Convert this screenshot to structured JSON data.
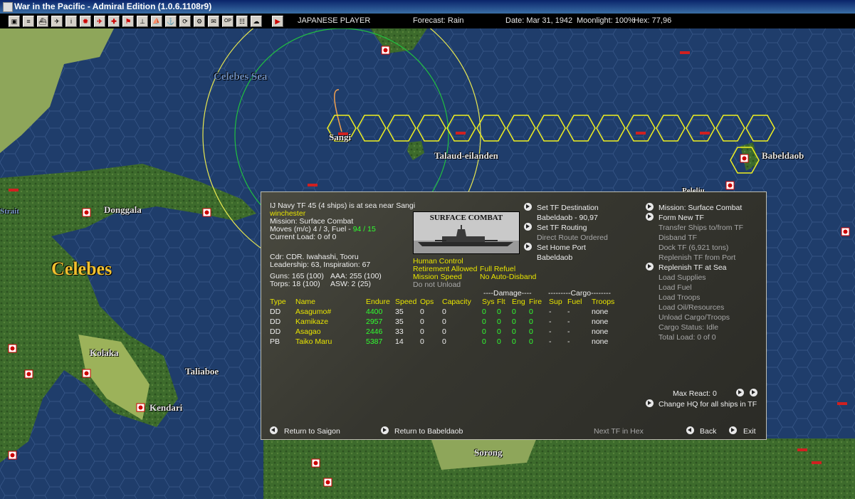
{
  "window": {
    "title": "War in the Pacific - Admiral Edition (1.0.6.1108r9)"
  },
  "toolbar": {
    "player": "JAPANESE PLAYER",
    "forecast": "Forecast: Rain",
    "date": "Date: Mar 31, 1942",
    "moonlight": "Moonlight: 100%",
    "hex": "Hex: 77,96",
    "button_icons": [
      "map-icon",
      "list-icon",
      "ships-icon",
      "air-icon",
      "info-icon",
      "flag-icon",
      "fighter-icon",
      "base-flag-icon",
      "carrier-icon",
      "landing-icon",
      "fleet-icon",
      "recycle-icon",
      "cycle-icon",
      "options-icon",
      "commands-icon",
      "report-icon",
      "end-turn-icon"
    ]
  },
  "map": {
    "labels": {
      "celebes_sea": "Celebes Sea",
      "sangi": "Sangi",
      "talaud": "Talaud-eilanden",
      "babeldaob": "Babeldaob",
      "donggala": "Donggala",
      "celebes": "Celebes",
      "kolaka": "Kolaka",
      "taliaboe": "Taliaboe",
      "kendari": "Kendari",
      "sorong": "Sorong",
      "peleliu": "Peleliu",
      "strait": "Strait"
    },
    "colors": {
      "sea": "#1f3d6b",
      "land": "#3a6b2a",
      "hex_path": "#f0f020",
      "range_inner": "#20c040"
    }
  },
  "tf": {
    "header": "IJ Navy TF 45 (4 ships) is at sea near Sangi",
    "flagship": "winchester",
    "mission": "Mission: Surface Combat",
    "moves_label": "Moves (m/c)  4 / 3, Fuel - ",
    "fuel": "94 / 15",
    "current_load": "Current Load:  0 of 0",
    "commander": "Cdr: CDR. Iwahashi, Tooru",
    "leadership": "Leadership: 63, Inspiration: 67",
    "guns": "Guns: 165 (100)",
    "aaa": "AAA: 255 (100)",
    "torps": "Torps: 18 (100)",
    "asw": "ASW: 2 (25)"
  },
  "mission_image": {
    "caption": "SURFACE COMBAT"
  },
  "control": {
    "human_control": "Human Control",
    "retirement": "Retirement Allowed",
    "full_refuel": "Full Refuel",
    "mission_speed": "Mission Speed",
    "no_auto_disband": "No Auto-Disband",
    "do_not_unload": "Do not Unload"
  },
  "destination": {
    "set_dest": "Set TF Destination",
    "dest_value": "Babeldaob - 90,97",
    "set_routing": "Set TF Routing",
    "routing_value": "Direct Route Ordered",
    "set_home": "Set Home Port",
    "home_value": "Babeldaob"
  },
  "actions": {
    "mission": "Mission: Surface Combat",
    "form_new": "Form New TF",
    "transfer": "Transfer Ships to/from TF",
    "disband": "Disband TF",
    "dock": "Dock TF (6,921 tons)",
    "replenish_port": "Replenish TF from Port",
    "replenish_sea": "Replenish TF at Sea",
    "load_supplies": "Load Supplies",
    "load_fuel": "Load Fuel",
    "load_troops": "Load Troops",
    "load_oil": "Load Oil/Resources",
    "unload": "Unload Cargo/Troops",
    "cargo_status": "Cargo Status: Idle",
    "total_load": "Total Load: 0 of 0"
  },
  "table": {
    "group_damage": "----Damage----",
    "group_cargo": "---------Cargo--------",
    "headers": [
      "Type",
      "Name",
      "Endure",
      "Speed",
      "Ops",
      "Capacity",
      "Sys",
      "Flt",
      "Eng",
      "Fire",
      "Sup",
      "Fuel",
      "Troops"
    ],
    "rows": [
      {
        "type": "DD",
        "name": "Asagumo#",
        "endure": "4400",
        "speed": "35",
        "ops": "0",
        "capacity": "0",
        "sys": "0",
        "flt": "0",
        "eng": "0",
        "fire": "0",
        "sup": "-",
        "fuel": "-",
        "troops": "none"
      },
      {
        "type": "DD",
        "name": "Kamikaze",
        "endure": "2957",
        "speed": "35",
        "ops": "0",
        "capacity": "0",
        "sys": "0",
        "flt": "0",
        "eng": "0",
        "fire": "0",
        "sup": "-",
        "fuel": "-",
        "troops": "none"
      },
      {
        "type": "DD",
        "name": "Asagao",
        "endure": "2446",
        "speed": "33",
        "ops": "0",
        "capacity": "0",
        "sys": "0",
        "flt": "0",
        "eng": "0",
        "fire": "0",
        "sup": "-",
        "fuel": "-",
        "troops": "none"
      },
      {
        "type": "PB",
        "name": "Taiko Maru",
        "endure": "5387",
        "speed": "14",
        "ops": "0",
        "capacity": "0",
        "sys": "0",
        "flt": "0",
        "eng": "0",
        "fire": "0",
        "sup": "-",
        "fuel": "-",
        "troops": "none"
      }
    ]
  },
  "react": {
    "max_react": "Max React:  0",
    "change_hq": "Change HQ for all ships in TF"
  },
  "footer": {
    "return_saigon": "Return to Saigon",
    "return_babeldaob": "Return to Babeldaob",
    "next_tf": "Next TF in Hex",
    "back": "Back",
    "exit": "Exit"
  }
}
